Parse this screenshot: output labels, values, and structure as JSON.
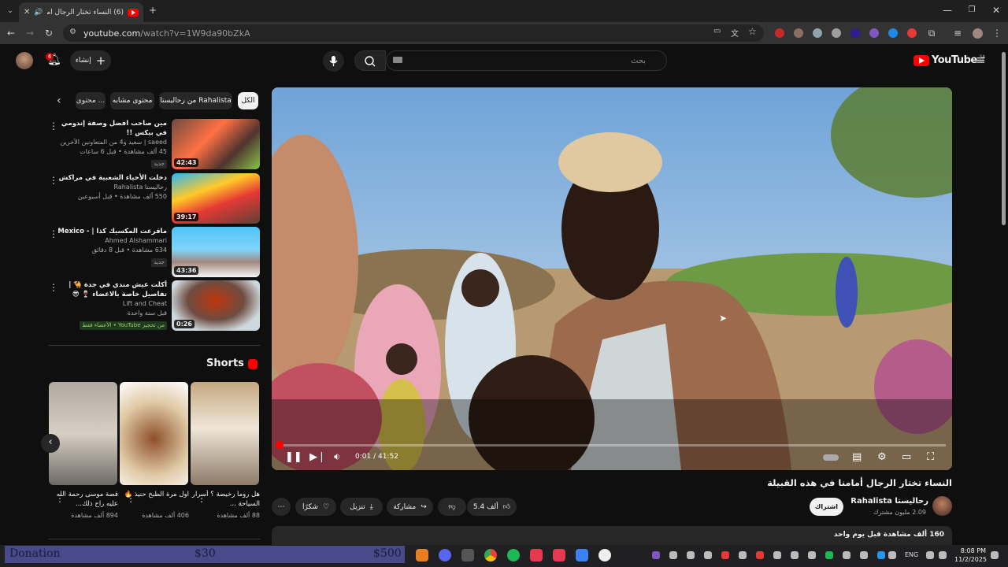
{
  "browser": {
    "tab_title": "(6) النساء تختار الرجال أمامنا في",
    "url_host": "youtube.com",
    "url_path": "/watch?v=1W9da90bZkA"
  },
  "header": {
    "create_label": "إنشاء",
    "notification_count": "6",
    "search_placeholder": "بحث",
    "logo_text": "YouTube",
    "logo_region": "SA"
  },
  "chips": [
    {
      "label": "الكل"
    },
    {
      "label": "من رحالیستا Rahalista"
    },
    {
      "label": "محتوى مشابه"
    },
    {
      "label": "محتوى ..."
    }
  ],
  "recommendations": [
    {
      "title": "مين صاحب افضل وصفة إندومي في بيكس !!",
      "channel": "saeed | سعيد و4 من المتعاونين الآخرين",
      "meta": "45 ألف مشاهدة • قبل 6 ساعات",
      "badge": "جديد",
      "duration": "42:43"
    },
    {
      "title": "دخلت الأحياء الشعبية في مراكش",
      "channel": "رحاليستا Rahalista",
      "meta": "550 ألف مشاهدة • قبل أسبوعين",
      "badge": "",
      "duration": "39:17"
    },
    {
      "title": "ماقرعت المكسيك كذا | - Mexico",
      "channel": "Ahmed Alshammari",
      "meta": "634 مشاهدة • قبل 8 دقائق",
      "badge": "جديد",
      "duration": "43:36"
    },
    {
      "title": "أكلت عيش مندي في جدة 🐪 | تفاصيل خاصة بالاعضاء 🍷 😎",
      "channel": "Lift and Cheat",
      "meta": "قبل سنة واحدة",
      "badge": "من تحجيز YouTube • الأعضاء فقط",
      "duration": "0:26"
    }
  ],
  "shorts": {
    "heading": "Shorts",
    "items": [
      {
        "title": "هل روما رخيصة ؟ أسرار السياحة ...",
        "views": "88 ألف مشاهدة"
      },
      {
        "title": "اول مرة الطبخ حنيذ 🔥",
        "views": "406 ألف مشاهدة"
      },
      {
        "title": "قصة موسى رحمة الله عليه راح ذلك...",
        "views": "894 ألف مشاهدة"
      }
    ]
  },
  "player": {
    "time_current": "0:01",
    "time_total": "41:52",
    "progress": 0.0004
  },
  "video": {
    "title": "النساء تختار الرجال أمامنا في هذه القبيلة",
    "channel_name": "رحاليستا Rahalista",
    "subscribers": "2.09 مليون مشترك",
    "subscribe_label": "اشتراك",
    "likes": "5.4 ألف",
    "share_label": "مشاركة",
    "download_label": "تنزيل",
    "thanks_label": "شكرًا",
    "description_meta": "160 ألف مشاهدة قبل يوم واحد"
  },
  "taskbar": {
    "donation_label": "Donation",
    "amount_1": "$30",
    "amount_2": "$500",
    "language": "ENG",
    "time": "8:08 PM",
    "date": "11/2/2025"
  }
}
